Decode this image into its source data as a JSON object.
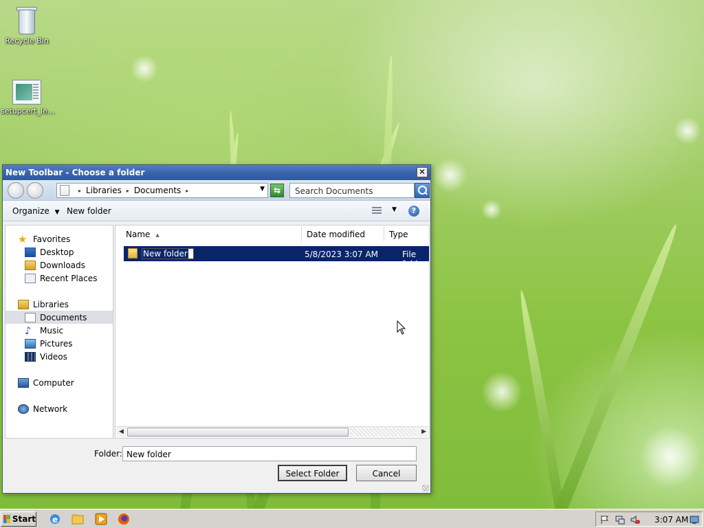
{
  "desktop": {
    "icons": [
      {
        "label": "Recycle Bin"
      },
      {
        "label": "setupcert_le..."
      }
    ]
  },
  "dialog": {
    "title": "New Toolbar - Choose a folder",
    "close_glyph": "✕",
    "breadcrumb": [
      "Libraries",
      "Documents"
    ],
    "search_placeholder": "Search Documents",
    "organize_label": "Organize",
    "new_folder_label": "New folder",
    "help_glyph": "?",
    "nav": {
      "favorites": "Favorites",
      "desktop": "Desktop",
      "downloads": "Downloads",
      "recent_places": "Recent Places",
      "libraries": "Libraries",
      "documents": "Documents",
      "music": "Music",
      "pictures": "Pictures",
      "videos": "Videos",
      "computer": "Computer",
      "network": "Network"
    },
    "columns": {
      "name": "Name",
      "date": "Date modified",
      "type": "Type"
    },
    "files": [
      {
        "name": "New folder",
        "date": "5/8/2023 3:07 AM",
        "type": "File folder"
      }
    ],
    "folder_label": "Folder:",
    "folder_value": "New folder",
    "select_button": "Select Folder",
    "cancel_button": "Cancel"
  },
  "taskbar": {
    "start_label": "Start",
    "clock": "3:07 AM"
  },
  "colors": {
    "title_bar": "#3a64ad",
    "selection": "#0a246a",
    "desktop_green": "#8cc443"
  }
}
